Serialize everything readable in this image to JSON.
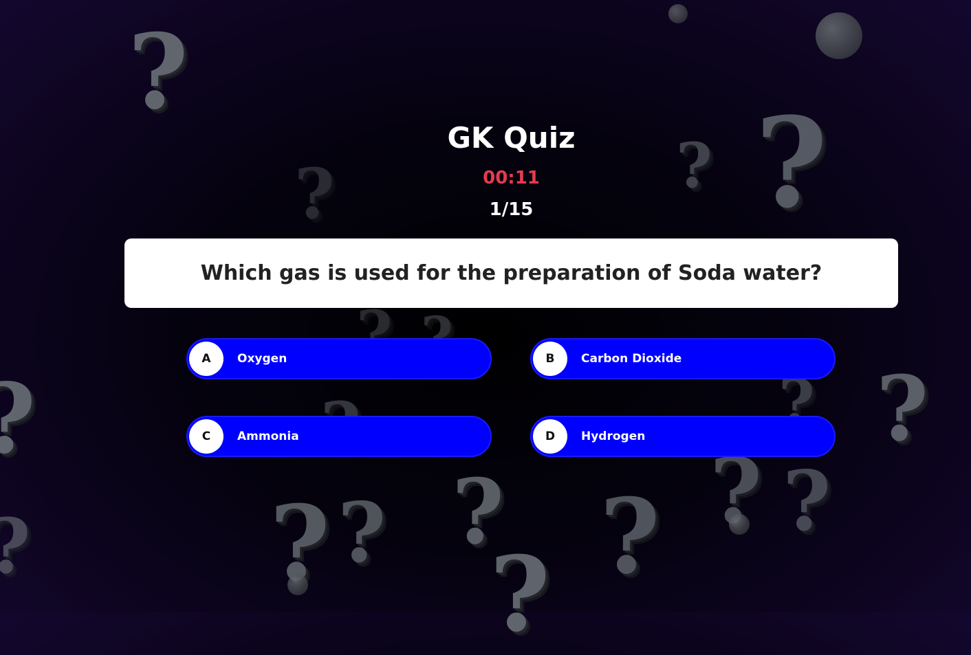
{
  "quiz": {
    "title": "GK Quiz",
    "timer": "00:11",
    "progress": "1/15",
    "question": "Which gas is used for the preparation of Soda water?"
  },
  "options": [
    {
      "letter": "A",
      "text": "Oxygen"
    },
    {
      "letter": "B",
      "text": "Carbon Dioxide"
    },
    {
      "letter": "C",
      "text": "Ammonia"
    },
    {
      "letter": "D",
      "text": "Hydrogen"
    }
  ],
  "background": {
    "icon": "question-mark-icon",
    "glyph": "?"
  },
  "colors": {
    "option_bg": "#0000ff",
    "timer": "#e53b4f",
    "question_bg": "#ffffff",
    "page_bg": "#05020f"
  }
}
